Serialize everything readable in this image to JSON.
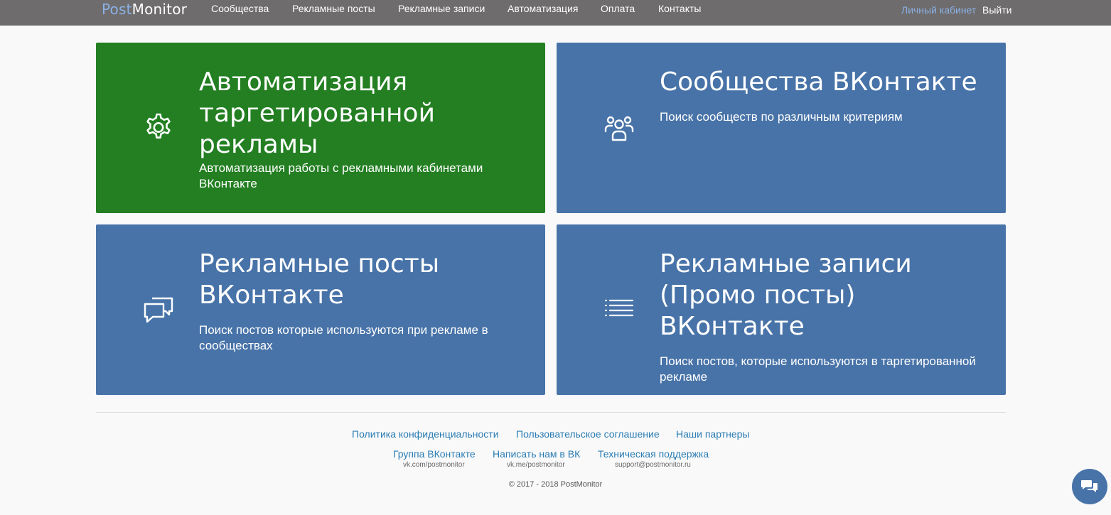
{
  "brand": {
    "part1": "Post",
    "part2": "Monitor"
  },
  "nav": {
    "items": [
      {
        "label": "Сообщества"
      },
      {
        "label": "Рекламные посты"
      },
      {
        "label": "Рекламные записи"
      },
      {
        "label": "Автоматизация"
      },
      {
        "label": "Оплата"
      },
      {
        "label": "Контакты"
      }
    ],
    "cabinet": "Личный кабинет",
    "logout": "Выйти"
  },
  "cards": [
    {
      "title": "Автоматизация таргетированной рекламы",
      "description": "Автоматизация работы с рекламными кабинетами ВКонтакте",
      "icon": "gear-icon",
      "color": "#237f22"
    },
    {
      "title": "Сообщества ВКонтакте",
      "description": "Поиск сообществ по различным критериям",
      "icon": "users-icon",
      "color": "#4873a8"
    },
    {
      "title": "Рекламные посты ВКонтакте",
      "description": "Поиск постов которые используются при рекламе в сообществах",
      "icon": "chat-bubbles-icon",
      "color": "#4873a8"
    },
    {
      "title": "Рекламные записи (Промо посты) ВКонтакте",
      "description": "Поиск постов, которые используются в таргетированной рекламе",
      "icon": "list-icon",
      "color": "#4873a8"
    }
  ],
  "footer": {
    "row1": [
      {
        "label": "Политика конфиденциальности"
      },
      {
        "label": "Пользовательское соглашение"
      },
      {
        "label": "Наши партнеры"
      }
    ],
    "row2": [
      {
        "label": "Группа ВКонтакте",
        "sub": "vk.com/postmonitor"
      },
      {
        "label": "Написать нам в ВК",
        "sub": "vk.me/postmonitor"
      },
      {
        "label": "Техническая поддержка",
        "sub": "support@postmonitor.ru"
      }
    ],
    "copyright": "© 2017 - 2018 PostMonitor"
  },
  "chat_button": {
    "icon": "chat-icon"
  }
}
